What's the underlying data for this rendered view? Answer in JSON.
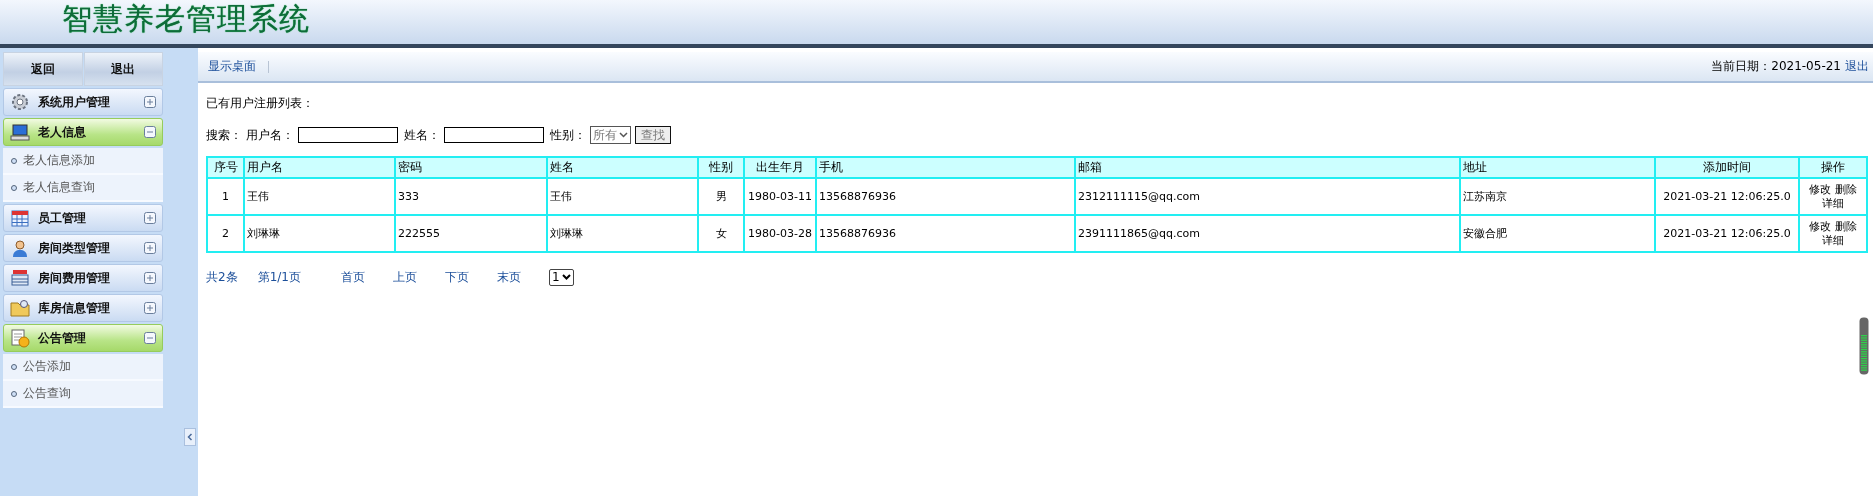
{
  "header": {
    "title": "智慧养老管理系统"
  },
  "sidebar": {
    "buttons": [
      "返回",
      "退出"
    ],
    "groups": [
      {
        "label": "系统用户管理",
        "expanded": false
      },
      {
        "label": "老人信息",
        "expanded": true,
        "children": [
          {
            "label": "老人信息添加"
          },
          {
            "label": "老人信息查询"
          }
        ]
      },
      {
        "label": "员工管理",
        "expanded": false
      },
      {
        "label": "房间类型管理",
        "expanded": false
      },
      {
        "label": "房间费用管理",
        "expanded": false
      },
      {
        "label": "库房信息管理",
        "expanded": false
      },
      {
        "label": "公告管理",
        "expanded": true,
        "children": [
          {
            "label": "公告添加"
          },
          {
            "label": "公告查询"
          }
        ]
      }
    ]
  },
  "toolbar": {
    "link": "显示桌面",
    "date": "当前日期：2021-05-21",
    "logout": "退出"
  },
  "content": {
    "heading": "已有用户注册列表：",
    "search": {
      "label": "搜索：",
      "fields": [
        {
          "label": "用户名：",
          "kind": "text"
        },
        {
          "label": "姓名：",
          "kind": "text"
        },
        {
          "label": "性别：",
          "kind": "select",
          "value": "所有"
        }
      ],
      "button": "查找"
    },
    "table": {
      "columns": [
        "序号",
        "用户名",
        "密码",
        "姓名",
        "性别",
        "出生年月",
        "手机",
        "邮箱",
        "地址",
        "添加时间",
        "操作"
      ],
      "rows": [
        {
          "cells": [
            "1",
            "王伟",
            "333",
            "王伟",
            "男",
            "1980-03-11",
            "13568876936",
            "2312111115@qq.com",
            "江苏南京",
            "2021-03-21 12:06:25.0"
          ],
          "actions": [
            "修改",
            "删除",
            "详细"
          ]
        },
        {
          "cells": [
            "2",
            "刘琳琳",
            "222555",
            "刘琳琳",
            "女",
            "1980-03-28",
            "13568876936",
            "2391111865@qq.com",
            "安徽合肥",
            "2021-03-21 12:06:25.0"
          ],
          "actions": [
            "修改",
            "删除",
            "详细"
          ]
        }
      ]
    },
    "pagination": {
      "total": "共2条",
      "page": "第1/1页",
      "links": [
        "首页",
        "上页",
        "下页",
        "末页"
      ],
      "select": "1"
    }
  }
}
